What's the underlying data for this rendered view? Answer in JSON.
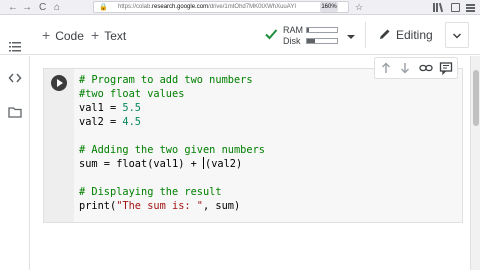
{
  "browser": {
    "back_glyph": "←",
    "forward_glyph": "→",
    "reload_glyph": "C",
    "home_glyph": "⌂",
    "lock_glyph": "🔒",
    "url_prefix": "https://colab.",
    "url_host": "research.google.com",
    "url_path": "/drive/1mtOhd7MK0tXWhXuuAYI",
    "zoom": "160%",
    "star_glyph": "☆"
  },
  "toolbar": {
    "code_label": "Code",
    "text_label": "Text",
    "ram_label": "RAM",
    "disk_label": "Disk",
    "ram_usage": 0.05,
    "disk_usage": 0.25,
    "editing_label": "Editing"
  },
  "cell": {
    "lines": [
      {
        "parts": [
          {
            "t": "# Program to add two numbers",
            "c": "comment"
          }
        ]
      },
      {
        "parts": [
          {
            "t": "#two float values",
            "c": "comment"
          }
        ]
      },
      {
        "parts": [
          {
            "t": "val1 = ",
            "c": "kw"
          },
          {
            "t": "5.5",
            "c": "num"
          }
        ]
      },
      {
        "parts": [
          {
            "t": "val2 = ",
            "c": "kw"
          },
          {
            "t": "4.5",
            "c": "num"
          }
        ]
      },
      {
        "parts": [
          {
            "t": "",
            "c": "kw"
          }
        ]
      },
      {
        "parts": [
          {
            "t": "# Adding the two given numbers",
            "c": "comment"
          }
        ]
      },
      {
        "parts": [
          {
            "t": "sum = float(val1) + ",
            "c": "kw"
          },
          {
            "t": "|",
            "c": "cursor"
          },
          {
            "t": "(val2)",
            "c": "kw"
          }
        ]
      },
      {
        "parts": [
          {
            "t": "",
            "c": "kw"
          }
        ]
      },
      {
        "parts": [
          {
            "t": "# Displaying the result",
            "c": "comment"
          }
        ]
      },
      {
        "parts": [
          {
            "t": "print(",
            "c": "kw"
          },
          {
            "t": "\"The sum is: \"",
            "c": "str"
          },
          {
            "t": ", sum)",
            "c": "kw"
          }
        ]
      }
    ]
  },
  "colors": {
    "comment": "#008000",
    "number": "#09885a",
    "string": "#a31515",
    "check": "#1e8e3e"
  },
  "icons": [
    "back-icon",
    "forward-icon",
    "reload-icon",
    "home-icon",
    "lock-icon",
    "star-icon",
    "library-icon",
    "reader-icon",
    "menu-icon",
    "check-icon",
    "caret-down-icon",
    "pencil-icon",
    "chevron-up-icon",
    "toc-icon",
    "code-brackets-icon",
    "folder-icon",
    "arrow-up-icon",
    "arrow-down-icon",
    "link-icon",
    "comment-icon",
    "run-icon"
  ]
}
